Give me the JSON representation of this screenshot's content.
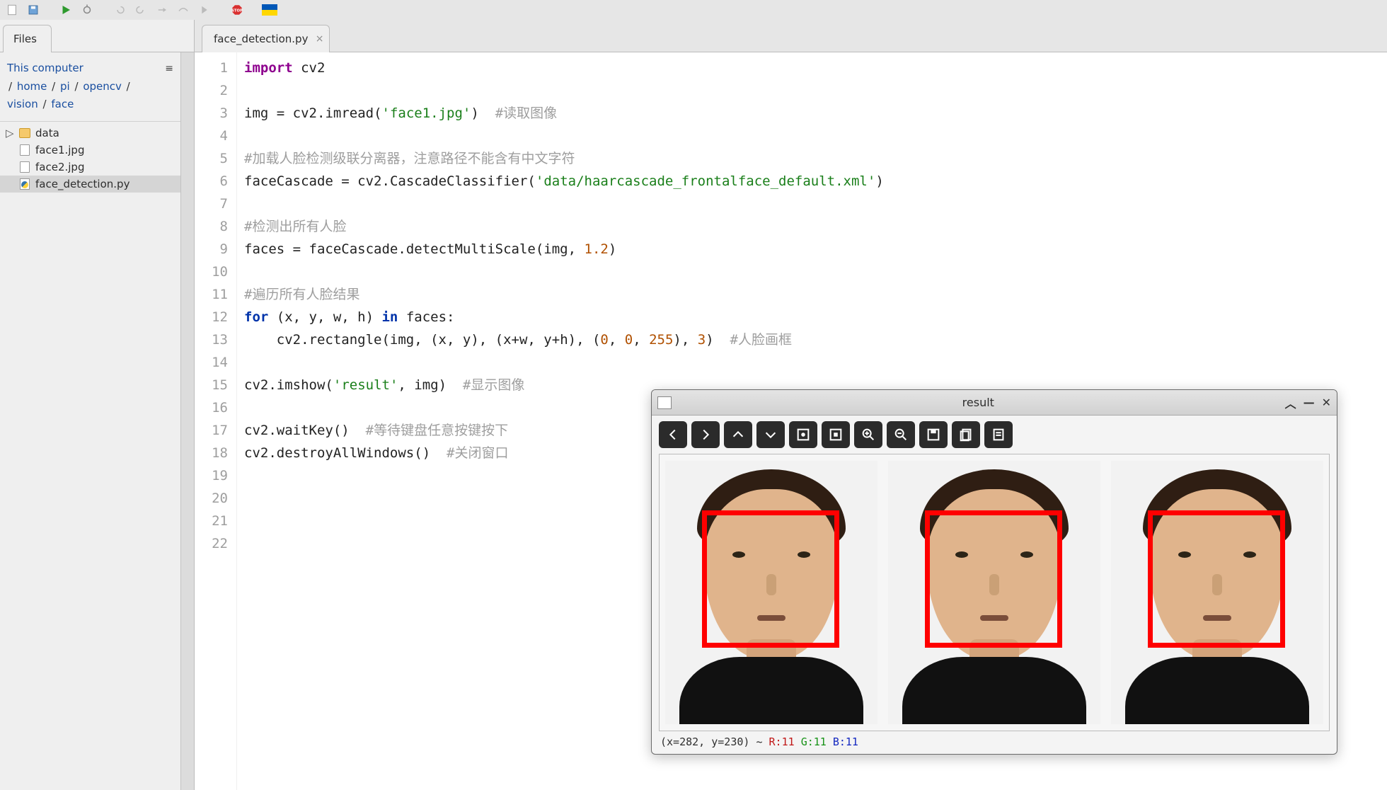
{
  "toolbar": {
    "icons": [
      "new-file",
      "save",
      "run",
      "debug",
      "undo",
      "redo",
      "step",
      "replay",
      "record",
      "stop",
      "flag"
    ]
  },
  "filesPanel": {
    "tabLabel": "Files",
    "breadcrumb": [
      "This computer",
      "home",
      "pi",
      "opencv",
      "vision",
      "face"
    ],
    "tree": [
      {
        "name": "data",
        "kind": "folder",
        "expandable": true
      },
      {
        "name": "face1.jpg",
        "kind": "file"
      },
      {
        "name": "face2.jpg",
        "kind": "file"
      },
      {
        "name": "face_detection.py",
        "kind": "python",
        "selected": true
      }
    ]
  },
  "editor": {
    "tabName": "face_detection.py",
    "lineCount": 22,
    "lines": [
      [
        {
          "t": "import ",
          "c": "kw2"
        },
        {
          "t": "cv2"
        }
      ],
      [],
      [
        {
          "t": "img "
        },
        {
          "t": "=",
          "c": ""
        },
        {
          "t": " cv2"
        },
        {
          "t": ".",
          "c": ""
        },
        {
          "t": "imread"
        },
        {
          "t": "("
        },
        {
          "t": "'face1.jpg'",
          "c": "str"
        },
        {
          "t": ")  "
        },
        {
          "t": "#读取图像",
          "c": "cmt"
        }
      ],
      [],
      [
        {
          "t": "#加载人脸检测级联分离器，注意路径不能含有中文字符",
          "c": "cmt"
        }
      ],
      [
        {
          "t": "faceCascade "
        },
        {
          "t": "="
        },
        {
          "t": " cv2"
        },
        {
          "t": "."
        },
        {
          "t": "CascadeClassifier"
        },
        {
          "t": "("
        },
        {
          "t": "'data/haarcascade_frontalface_default.xml'",
          "c": "str"
        },
        {
          "t": ")"
        }
      ],
      [],
      [
        {
          "t": "#检测出所有人脸",
          "c": "cmt"
        }
      ],
      [
        {
          "t": "faces "
        },
        {
          "t": "="
        },
        {
          "t": " faceCascade"
        },
        {
          "t": "."
        },
        {
          "t": "detectMultiScale"
        },
        {
          "t": "(img, "
        },
        {
          "t": "1.2",
          "c": "num"
        },
        {
          "t": ")"
        }
      ],
      [],
      [
        {
          "t": "#遍历所有人脸结果",
          "c": "cmt"
        }
      ],
      [
        {
          "t": "for ",
          "c": "kw"
        },
        {
          "t": "(x, y, w, h) "
        },
        {
          "t": "in ",
          "c": "kw"
        },
        {
          "t": "faces:"
        }
      ],
      [
        {
          "t": "    cv2"
        },
        {
          "t": "."
        },
        {
          "t": "rectangle"
        },
        {
          "t": "(img, (x, y), (x"
        },
        {
          "t": "+"
        },
        {
          "t": "w, y"
        },
        {
          "t": "+"
        },
        {
          "t": "h), ("
        },
        {
          "t": "0",
          "c": "num"
        },
        {
          "t": ", "
        },
        {
          "t": "0",
          "c": "num"
        },
        {
          "t": ", "
        },
        {
          "t": "255",
          "c": "num"
        },
        {
          "t": "), "
        },
        {
          "t": "3",
          "c": "num"
        },
        {
          "t": ")  "
        },
        {
          "t": "#人脸画框",
          "c": "cmt"
        }
      ],
      [],
      [
        {
          "t": "cv2"
        },
        {
          "t": "."
        },
        {
          "t": "imshow"
        },
        {
          "t": "("
        },
        {
          "t": "'result'",
          "c": "str"
        },
        {
          "t": ", img)  "
        },
        {
          "t": "#显示图像",
          "c": "cmt"
        }
      ],
      [],
      [
        {
          "t": "cv2"
        },
        {
          "t": "."
        },
        {
          "t": "waitKey"
        },
        {
          "t": "()  "
        },
        {
          "t": "#等待键盘任意按键按下",
          "c": "cmt"
        }
      ],
      [
        {
          "t": "cv2"
        },
        {
          "t": "."
        },
        {
          "t": "destroyAllWindows"
        },
        {
          "t": "()  "
        },
        {
          "t": "#关闭窗口",
          "c": "cmt"
        }
      ],
      [],
      [],
      [],
      []
    ]
  },
  "resultWindow": {
    "title": "result",
    "toolbarIcons": [
      "back",
      "forward",
      "up",
      "down",
      "fit",
      "original",
      "zoom-in",
      "zoom-out",
      "save",
      "copy",
      "properties"
    ],
    "status": {
      "prefix": "(x=282, y=230) ~ ",
      "r": "R:11",
      "g": "G:11",
      "b": "B:11"
    }
  }
}
